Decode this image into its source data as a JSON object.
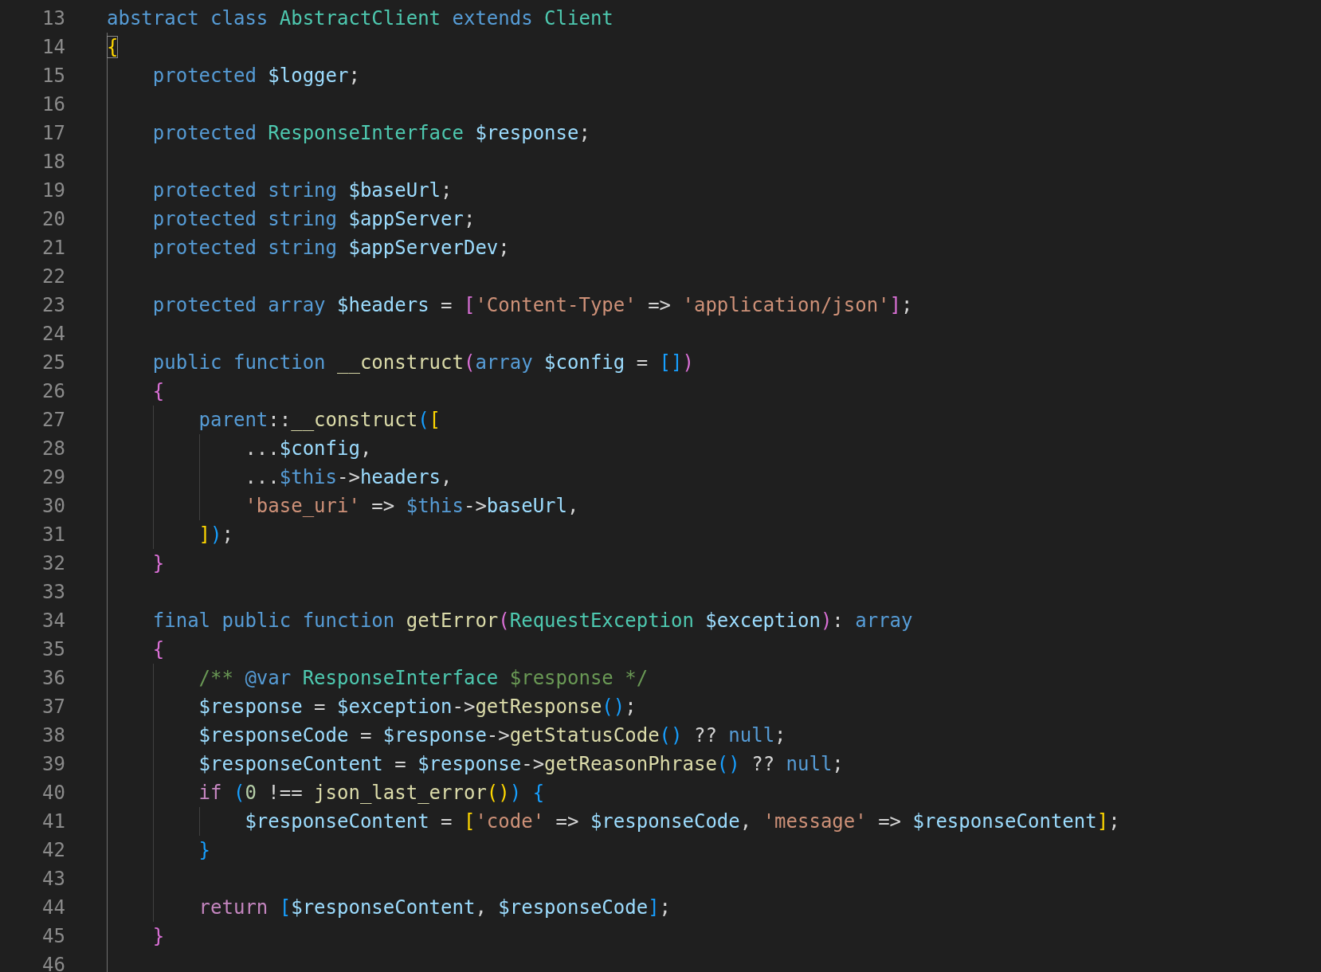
{
  "editor": {
    "lines": [
      {
        "number": "13",
        "tokens": [
          {
            "text": "abstract class ",
            "kind": "kw"
          },
          {
            "text": "AbstractClient",
            "kind": "type"
          },
          {
            "text": " extends ",
            "kind": "kw"
          },
          {
            "text": "Client",
            "kind": "type"
          }
        ]
      },
      {
        "number": "14",
        "tokens": [
          {
            "text": "{",
            "kind": "b1",
            "matched": true
          }
        ]
      },
      {
        "number": "15",
        "tokens": [
          {
            "text": "    protected ",
            "kind": "kw"
          },
          {
            "text": "$logger",
            "kind": "var"
          },
          {
            "text": ";",
            "kind": "op"
          }
        ]
      },
      {
        "number": "16"
      },
      {
        "number": "17",
        "tokens": [
          {
            "text": "    protected ",
            "kind": "kw"
          },
          {
            "text": "ResponseInterface",
            "kind": "type"
          },
          {
            "text": " $response",
            "kind": "var"
          },
          {
            "text": ";",
            "kind": "op"
          }
        ]
      },
      {
        "number": "18"
      },
      {
        "number": "19",
        "tokens": [
          {
            "text": "    protected string ",
            "kind": "kw"
          },
          {
            "text": "$baseUrl",
            "kind": "var"
          },
          {
            "text": ";",
            "kind": "op"
          }
        ]
      },
      {
        "number": "20",
        "tokens": [
          {
            "text": "    protected string ",
            "kind": "kw"
          },
          {
            "text": "$appServer",
            "kind": "var"
          },
          {
            "text": ";",
            "kind": "op"
          }
        ]
      },
      {
        "number": "21",
        "tokens": [
          {
            "text": "    protected string ",
            "kind": "kw"
          },
          {
            "text": "$appServerDev",
            "kind": "var"
          },
          {
            "text": ";",
            "kind": "op"
          }
        ]
      },
      {
        "number": "22"
      },
      {
        "number": "23",
        "tokens": [
          {
            "text": "    protected array ",
            "kind": "kw"
          },
          {
            "text": "$headers",
            "kind": "var"
          },
          {
            "text": " = ",
            "kind": "op"
          },
          {
            "text": "[",
            "kind": "b2",
            "matched": false
          },
          {
            "text": "'Content-Type'",
            "kind": "str"
          },
          {
            "text": " => ",
            "kind": "op"
          },
          {
            "text": "'application/json'",
            "kind": "str"
          },
          {
            "text": "]",
            "kind": "b2",
            "matched": false
          },
          {
            "text": ";",
            "kind": "op"
          }
        ]
      },
      {
        "number": "24"
      },
      {
        "number": "25",
        "tokens": [
          {
            "text": "    public function ",
            "kind": "kw"
          },
          {
            "text": "__construct",
            "kind": "fn"
          },
          {
            "text": "(",
            "kind": "b2",
            "matched": false
          },
          {
            "text": "array ",
            "kind": "kw"
          },
          {
            "text": "$config",
            "kind": "var"
          },
          {
            "text": " = ",
            "kind": "op"
          },
          {
            "text": "[]",
            "kind": "b3",
            "matched": false
          },
          {
            "text": ")",
            "kind": "b2",
            "matched": false
          }
        ]
      },
      {
        "number": "26",
        "tokens": [
          {
            "text": "    {",
            "kind": "b2",
            "matched": false
          }
        ]
      },
      {
        "number": "27",
        "tokens": [
          {
            "text": "        parent",
            "kind": "kw"
          },
          {
            "text": "::",
            "kind": "op"
          },
          {
            "text": "__construct",
            "kind": "fn"
          },
          {
            "text": "(",
            "kind": "b3",
            "matched": false
          },
          {
            "text": "[",
            "kind": "b1",
            "matched": false
          }
        ]
      },
      {
        "number": "28",
        "tokens": [
          {
            "text": "            ...",
            "kind": "op"
          },
          {
            "text": "$config",
            "kind": "var"
          },
          {
            "text": ",",
            "kind": "op"
          }
        ]
      },
      {
        "number": "29",
        "tokens": [
          {
            "text": "            ...",
            "kind": "op"
          },
          {
            "text": "$this",
            "kind": "kw"
          },
          {
            "text": "->",
            "kind": "op"
          },
          {
            "text": "headers",
            "kind": "var"
          },
          {
            "text": ",",
            "kind": "op"
          }
        ]
      },
      {
        "number": "30",
        "tokens": [
          {
            "text": "            'base_uri'",
            "kind": "str"
          },
          {
            "text": " => ",
            "kind": "op"
          },
          {
            "text": "$this",
            "kind": "kw"
          },
          {
            "text": "->",
            "kind": "op"
          },
          {
            "text": "baseUrl",
            "kind": "var"
          },
          {
            "text": ",",
            "kind": "op"
          }
        ]
      },
      {
        "number": "31",
        "tokens": [
          {
            "text": "        ]",
            "kind": "b1",
            "matched": false
          },
          {
            "text": ")",
            "kind": "b3",
            "matched": false
          },
          {
            "text": ";",
            "kind": "op"
          }
        ]
      },
      {
        "number": "32",
        "tokens": [
          {
            "text": "    }",
            "kind": "b2",
            "matched": false
          }
        ]
      },
      {
        "number": "33"
      },
      {
        "number": "34",
        "tokens": [
          {
            "text": "    final public function ",
            "kind": "kw"
          },
          {
            "text": "getError",
            "kind": "fn"
          },
          {
            "text": "(",
            "kind": "b2",
            "matched": false
          },
          {
            "text": "RequestException",
            "kind": "type"
          },
          {
            "text": " $exception",
            "kind": "var"
          },
          {
            "text": ")",
            "kind": "b2",
            "matched": false
          },
          {
            "text": ": ",
            "kind": "op"
          },
          {
            "text": "array",
            "kind": "kw"
          }
        ]
      },
      {
        "number": "35",
        "tokens": [
          {
            "text": "    {",
            "kind": "b2",
            "matched": false
          }
        ]
      },
      {
        "number": "36",
        "tokens": [
          {
            "text": "        /** ",
            "kind": "cmt"
          },
          {
            "text": "@var",
            "kind": "kw"
          },
          {
            "text": " ResponseInterface",
            "kind": "type"
          },
          {
            "text": " $response */",
            "kind": "cmt"
          }
        ]
      },
      {
        "number": "37",
        "tokens": [
          {
            "text": "        $response",
            "kind": "var"
          },
          {
            "text": " = ",
            "kind": "op"
          },
          {
            "text": "$exception",
            "kind": "var"
          },
          {
            "text": "->",
            "kind": "op"
          },
          {
            "text": "getResponse",
            "kind": "fn"
          },
          {
            "text": "()",
            "kind": "b3",
            "matched": false
          },
          {
            "text": ";",
            "kind": "op"
          }
        ]
      },
      {
        "number": "38",
        "tokens": [
          {
            "text": "        $responseCode",
            "kind": "var"
          },
          {
            "text": " = ",
            "kind": "op"
          },
          {
            "text": "$response",
            "kind": "var"
          },
          {
            "text": "->",
            "kind": "op"
          },
          {
            "text": "getStatusCode",
            "kind": "fn"
          },
          {
            "text": "()",
            "kind": "b3",
            "matched": false
          },
          {
            "text": " ?? ",
            "kind": "op"
          },
          {
            "text": "null",
            "kind": "kw"
          },
          {
            "text": ";",
            "kind": "op"
          }
        ]
      },
      {
        "number": "39",
        "tokens": [
          {
            "text": "        $responseContent",
            "kind": "var"
          },
          {
            "text": " = ",
            "kind": "op"
          },
          {
            "text": "$response",
            "kind": "var"
          },
          {
            "text": "->",
            "kind": "op"
          },
          {
            "text": "getReasonPhrase",
            "kind": "fn"
          },
          {
            "text": "()",
            "kind": "b3",
            "matched": false
          },
          {
            "text": " ?? ",
            "kind": "op"
          },
          {
            "text": "null",
            "kind": "kw"
          },
          {
            "text": ";",
            "kind": "op"
          }
        ]
      },
      {
        "number": "40",
        "tokens": [
          {
            "text": "        if ",
            "kind": "ctl"
          },
          {
            "text": "(",
            "kind": "b3",
            "matched": false
          },
          {
            "text": "0",
            "kind": "num"
          },
          {
            "text": " !== ",
            "kind": "op"
          },
          {
            "text": "json_last_error",
            "kind": "fn"
          },
          {
            "text": "()",
            "kind": "b1",
            "matched": false
          },
          {
            "text": ")",
            "kind": "b3",
            "matched": false
          },
          {
            "text": " {",
            "kind": "b3",
            "matched": false
          }
        ]
      },
      {
        "number": "41",
        "tokens": [
          {
            "text": "            $responseContent",
            "kind": "var"
          },
          {
            "text": " = ",
            "kind": "op"
          },
          {
            "text": "[",
            "kind": "b1",
            "matched": false
          },
          {
            "text": "'code'",
            "kind": "str"
          },
          {
            "text": " => ",
            "kind": "op"
          },
          {
            "text": "$responseCode",
            "kind": "var"
          },
          {
            "text": ", ",
            "kind": "op"
          },
          {
            "text": "'message'",
            "kind": "str"
          },
          {
            "text": " => ",
            "kind": "op"
          },
          {
            "text": "$responseContent",
            "kind": "var"
          },
          {
            "text": "]",
            "kind": "b1",
            "matched": false
          },
          {
            "text": ";",
            "kind": "op"
          }
        ]
      },
      {
        "number": "42",
        "tokens": [
          {
            "text": "        }",
            "kind": "b3",
            "matched": false
          }
        ]
      },
      {
        "number": "43"
      },
      {
        "number": "44",
        "tokens": [
          {
            "text": "        return ",
            "kind": "ctl"
          },
          {
            "text": "[",
            "kind": "b3",
            "matched": false
          },
          {
            "text": "$responseContent",
            "kind": "var"
          },
          {
            "text": ", ",
            "kind": "op"
          },
          {
            "text": "$responseCode",
            "kind": "var"
          },
          {
            "text": "]",
            "kind": "b3",
            "matched": false
          },
          {
            "text": ";",
            "kind": "op"
          }
        ]
      },
      {
        "number": "45",
        "tokens": [
          {
            "text": "    }",
            "kind": "b2",
            "matched": false
          }
        ]
      },
      {
        "number": "46"
      }
    ]
  }
}
